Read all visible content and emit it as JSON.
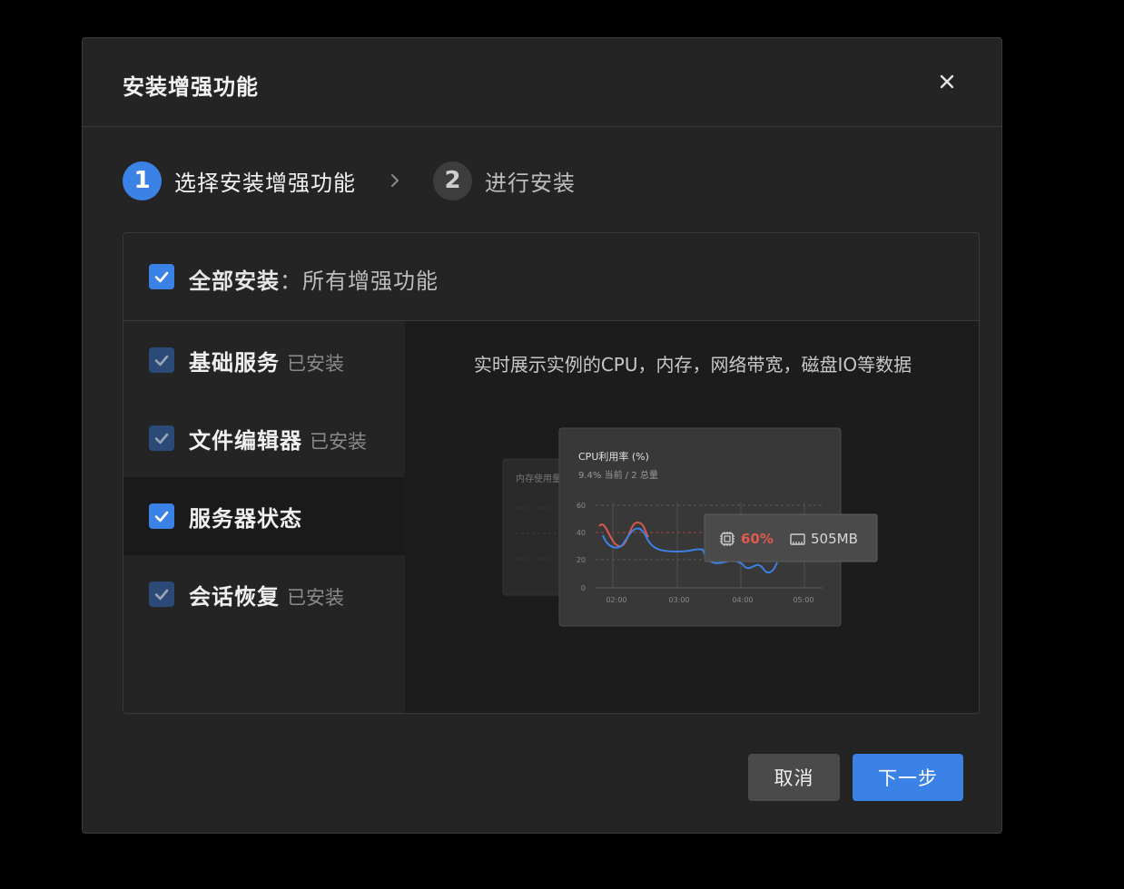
{
  "dialog": {
    "title": "安装增强功能",
    "close_label": "×"
  },
  "steps": [
    {
      "number": "1",
      "label": "选择安装增强功能",
      "active": true
    },
    {
      "number": "2",
      "label": "进行安装",
      "active": false
    }
  ],
  "select_all": {
    "label_bold": "全部安装",
    "label_rest": "：所有增强功能",
    "checked": true
  },
  "features": [
    {
      "name": "基础服务",
      "badge": "已安装",
      "checked": true,
      "disabled": true
    },
    {
      "name": "文件编辑器",
      "badge": "已安装",
      "checked": true,
      "disabled": true
    },
    {
      "name": "服务器状态",
      "badge": "",
      "checked": true,
      "disabled": false,
      "selected": true
    },
    {
      "name": "会话恢复",
      "badge": "已安装",
      "checked": true,
      "disabled": true
    }
  ],
  "preview": {
    "description": "实时展示实例的CPU，内存，网络带宽，磁盘IO等数据",
    "back_card_title": "内存使用量",
    "cpu_card": {
      "title": "CPU利用率 (%)",
      "subtitle": "9.4% 当前 / 2 总量",
      "y_ticks": [
        "60",
        "40",
        "20",
        "0"
      ],
      "x_ticks": [
        "02:00",
        "03:00",
        "04:00",
        "05:00"
      ]
    },
    "tooltip": {
      "cpu": "60%",
      "mem": "505MB"
    }
  },
  "footer": {
    "cancel_label": "取消",
    "next_label": "下一步"
  },
  "colors": {
    "accent": "#3b82e6",
    "alert": "#e05a4e"
  }
}
